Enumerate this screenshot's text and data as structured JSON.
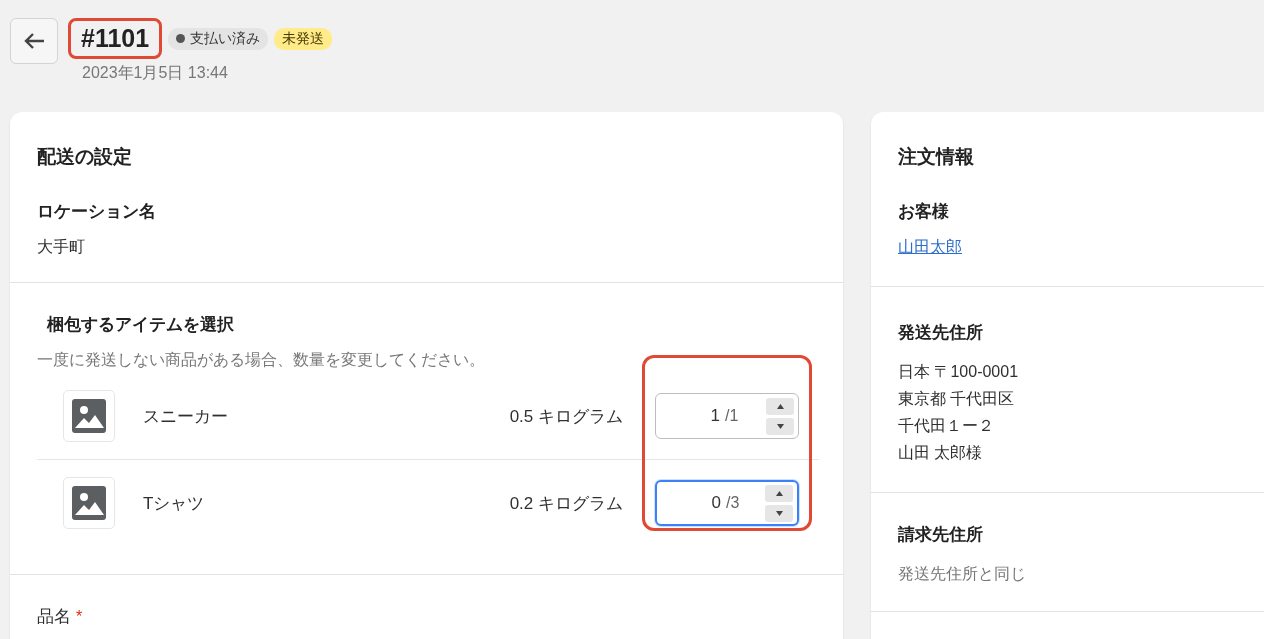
{
  "header": {
    "order_number": "#1101",
    "highlighted": true,
    "badges": [
      {
        "kind": "payment",
        "label": "支払い済み"
      },
      {
        "kind": "fulfillment",
        "label": "未発送"
      }
    ],
    "date": "2023年1月5日 13:44"
  },
  "shipping": {
    "title": "配送の設定",
    "location_label": "ロケーション名",
    "location": "大手町",
    "items_title": "梱包するアイテムを選択",
    "items_hint": "一度に発送しない商品がある場合、数量を変更してください。",
    "quantity_highlighted": true,
    "items": [
      {
        "name": "スニーカー",
        "weight": "0.5 キログラム",
        "quantity": "1",
        "total": "/1",
        "focused": false
      },
      {
        "name": "Tシャツ",
        "weight": "0.2 キログラム",
        "quantity": "0",
        "total": "/3",
        "focused": true
      }
    ],
    "product_name_label": "品名",
    "required_mark": "*"
  },
  "order_info": {
    "title": "注文情報",
    "customer_label": "お客様",
    "customer": "山田太郎",
    "shipping_address_label": "発送先住所",
    "shipping_address": [
      "日本 〒100-0001",
      "東京都 千代田区",
      "千代田１ー２",
      "山田 太郎様"
    ],
    "billing_address_label": "請求先住所",
    "billing_address": "発送先住所と同じ"
  }
}
